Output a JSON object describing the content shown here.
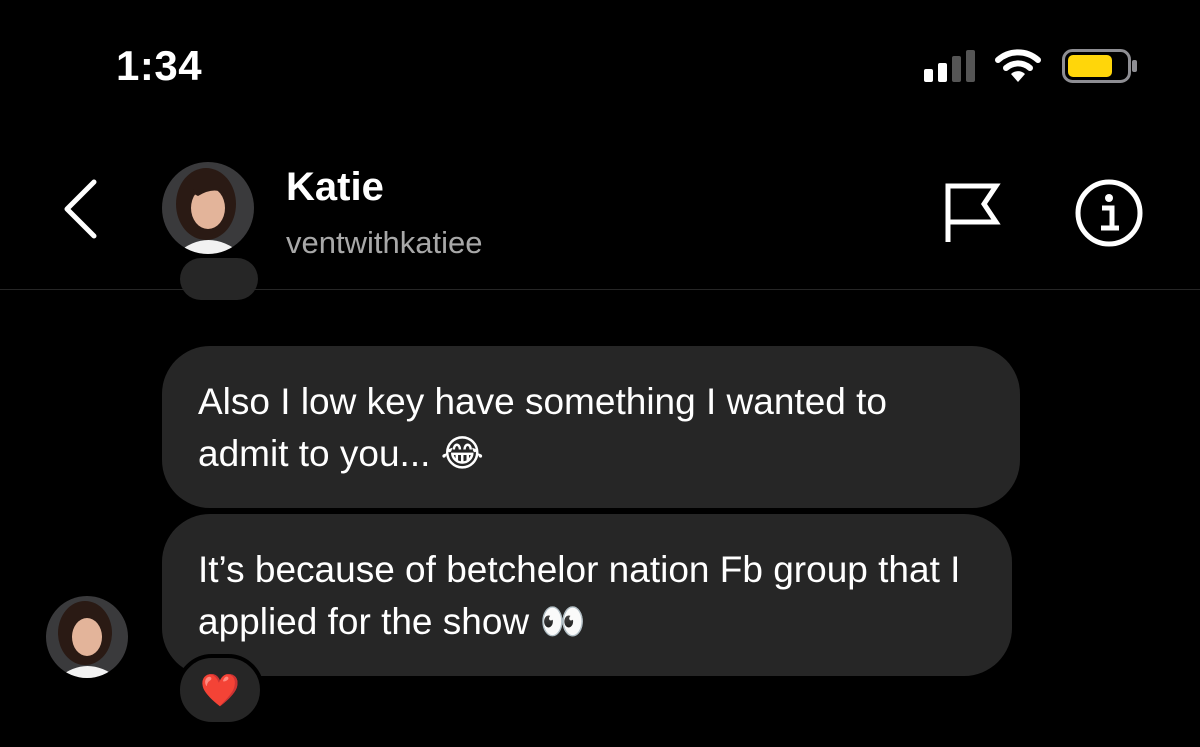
{
  "status_bar": {
    "time": "1:34",
    "battery_color": "#ffd60a"
  },
  "header": {
    "back_icon": "chevron-left-icon",
    "name": "Katie",
    "username": "ventwithkatiee",
    "report_icon": "flag-icon",
    "info_icon": "info-icon"
  },
  "messages": [
    {
      "sender": "Katie",
      "text_main": "Also I low key have something I wanted to admit to you...",
      "emoji": "😂"
    },
    {
      "sender": "Katie",
      "text_main": "It’s because of betchelor nation Fb group that I applied for the show",
      "emoji": "👀",
      "reaction": "❤️"
    }
  ],
  "colors": {
    "background": "#000000",
    "bubble": "#262626",
    "secondary_text": "#a8a8a8"
  }
}
